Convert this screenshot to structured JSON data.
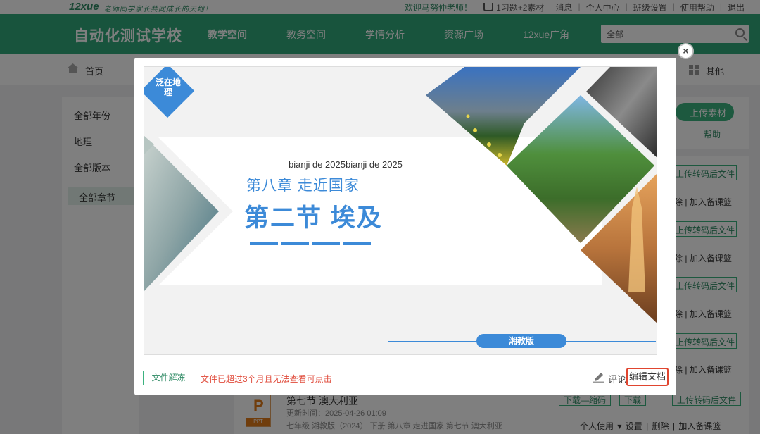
{
  "topbar": {
    "logo": "12xue",
    "slogan": "老师同学家长共同成长的天地！",
    "welcome": "欢迎马努仲老师！",
    "cart": "1习题+2素材",
    "links": [
      "消息",
      "个人中心",
      "班级设置",
      "使用帮助",
      "退出"
    ]
  },
  "navbar": {
    "school_name": "自动化测试学校",
    "items": [
      "教学空间",
      "教务空间",
      "学情分析",
      "资源广场",
      "12xue广角"
    ],
    "search_select": "全部"
  },
  "crumb": {
    "home": "首页",
    "other": "其他"
  },
  "sidebar": {
    "filters": [
      "全部年份",
      "地理",
      "全部版本"
    ],
    "chapter": "全部章节"
  },
  "right_panel": {
    "upload": "上传素材",
    "help": "帮助"
  },
  "list": {
    "convert_label": "上传转码后文件",
    "ops_fragment": "除",
    "add_lesson": "加入备课篮",
    "last_item": {
      "file_type": "PPT",
      "title": "第七节 澳大利亚",
      "time": "更新时间：2025-04-26 01:09",
      "meta": "七年级 湘教版（2024） 下册 第八章 走进国家 第七节 澳大利亚",
      "btn_download_all": "下载—缩码",
      "btn_download": "下载",
      "btn_convert": "上传转码后文件",
      "ops": [
        "个人使用",
        "设置",
        "删除",
        "加入备课篮"
      ]
    }
  },
  "modal": {
    "slide": {
      "badge": "泛在地理",
      "subtitle": "bianji de 2025bianji de 2025",
      "chapter": "第八章  走近国家",
      "title": "第二节  埃及",
      "edition": "湘教版"
    },
    "footer": {
      "unfreeze_btn": "文件解冻",
      "expired_note": "文件已超过3个月且无法查看可点击",
      "comment": "评论",
      "edit_doc": "编辑文档"
    },
    "close": "×"
  },
  "colors": {
    "brand_green": "#30a97a",
    "slide_blue": "#3c8ad8",
    "alert_red": "#e04b3b"
  }
}
